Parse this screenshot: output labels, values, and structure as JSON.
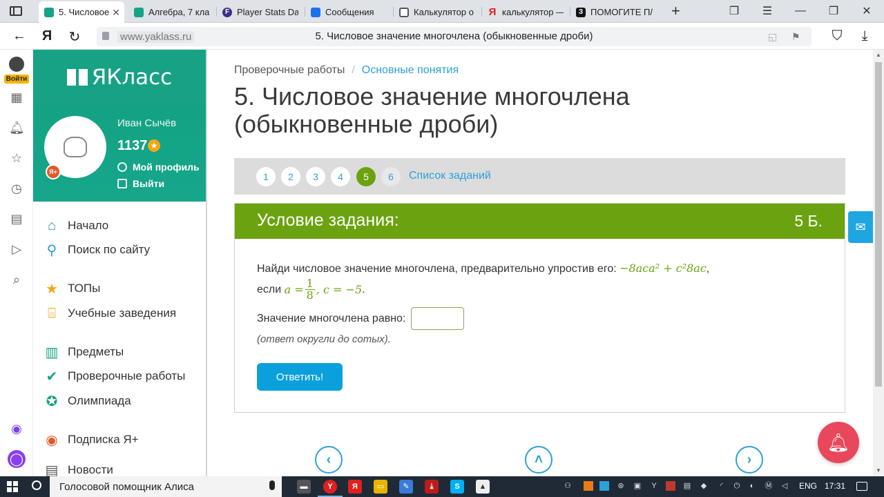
{
  "browser": {
    "tabs": [
      {
        "title": "5. Числовое",
        "icon_color": "#17a285",
        "active": true
      },
      {
        "title": "Алгебра, 7 кла",
        "icon_color": "#17a285"
      },
      {
        "title": "Player Stats Da",
        "icon_color": "#3b2e8a"
      },
      {
        "title": "Сообщения",
        "icon_color": "#1a73e8"
      },
      {
        "title": "Калькулятор о",
        "icon_color": "#555555"
      },
      {
        "title": "калькулятор —",
        "icon_color": "#e02020"
      },
      {
        "title": "ПОМОГИТЕ П/",
        "icon_color": "#111111"
      }
    ],
    "url_domain": "www.yaklass.ru",
    "page_title": "5. Числовое значение многочлена (обыкновенные дроби)"
  },
  "rail": {
    "login_label": "Войти"
  },
  "site": {
    "logo": "ЯКласс",
    "user": {
      "name": "Иван Сычёв",
      "score": "1137",
      "plus_badge": "Я+",
      "profile_link": "Мой профиль",
      "logout_link": "Выйти"
    },
    "menu": [
      {
        "label": "Начало",
        "icon": "home-icon"
      },
      {
        "label": "Поиск по сайту",
        "icon": "search-icon"
      },
      {
        "label": "ТОПы",
        "icon": "star-icon"
      },
      {
        "label": "Учебные заведения",
        "icon": "institution-icon"
      },
      {
        "label": "Предметы",
        "icon": "book-icon"
      },
      {
        "label": "Проверочные работы",
        "icon": "check-icon"
      },
      {
        "label": "Олимпиада",
        "icon": "medal-icon"
      },
      {
        "label": "Подписка Я+",
        "icon": "subscription-icon"
      },
      {
        "label": "Новости",
        "icon": "news-icon"
      }
    ]
  },
  "breadcrumbs": {
    "root": "Проверочные работы",
    "current": "Основные понятия"
  },
  "heading": "5. Числовое значение многочлена (обыкновенные дроби)",
  "steps": {
    "items": [
      "1",
      "2",
      "3",
      "4",
      "5",
      "6"
    ],
    "current": "5",
    "list_link": "Список заданий"
  },
  "task": {
    "header": "Условие задания:",
    "points": "5 Б.",
    "text_prefix": "Найди числовое значение многочлена, предварительно упростив его:",
    "expression": "−8aca² + c²8ac",
    "condition_prefix": "если",
    "var_a": "a =",
    "frac_num": "1",
    "frac_den": "8",
    "var_c": ", c = −5",
    "answer_label": "Значение многочлена равно:",
    "answer_value": "",
    "hint": "(ответ округли до сотых).",
    "submit": "Ответить!"
  },
  "taskbar": {
    "search_text": "Голосовой помощник Алиса",
    "lang": "ENG",
    "time": "17:31"
  },
  "colors": {
    "brand": "#17a285",
    "accent": "#6aa30f",
    "link": "#2ea0d8",
    "button": "#0aa0db"
  }
}
